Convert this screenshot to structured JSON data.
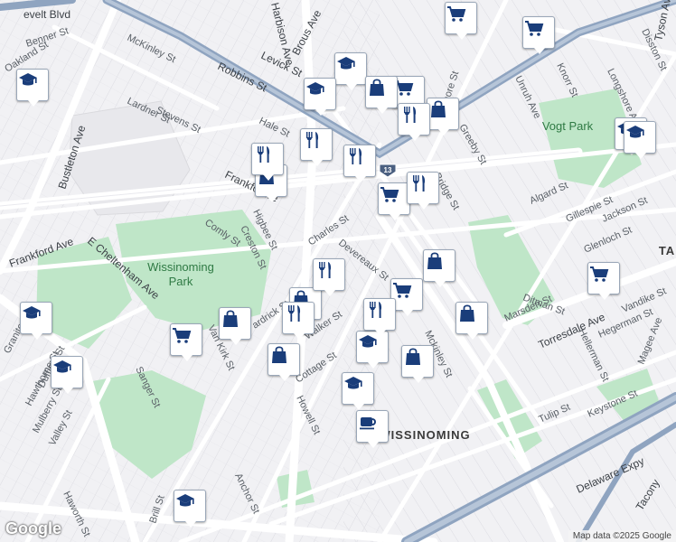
{
  "map": {
    "attribution": "Map data ©2025 Google",
    "logo": "Google",
    "neighborhood": "WISSINOMING",
    "parks": [
      {
        "name": "Wissinoming Park",
        "lines": [
          "Wissinoming",
          "Park"
        ]
      },
      {
        "name": "Vogt Park",
        "lines": [
          "Vogt Park"
        ]
      }
    ],
    "route_shield": "13",
    "corner_label": "TA",
    "streets": [
      {
        "name": "Roosevelt Blvd",
        "text": "evelt Blvd"
      },
      {
        "name": "Benner St",
        "text": "Benner St"
      },
      {
        "name": "Oakland St",
        "text": "Oakland St"
      },
      {
        "name": "McKinley St",
        "text": "McKinley St"
      },
      {
        "name": "Robbins St",
        "text": "Robbins St"
      },
      {
        "name": "Stevens St",
        "text": "Stevens St"
      },
      {
        "name": "Lardner St",
        "text": "Lardner St"
      },
      {
        "name": "Hale St",
        "text": "Hale St"
      },
      {
        "name": "Bustleton Ave",
        "text": "Bustleton Ave"
      },
      {
        "name": "Harbison Ave",
        "text": "Harbison Ave"
      },
      {
        "name": "Brous Ave",
        "text": "Brous Ave"
      },
      {
        "name": "Levick St",
        "text": "Levick St"
      },
      {
        "name": "Frankford Ave",
        "text": "Frankford Ave"
      },
      {
        "name": "Frankford Ave north",
        "text": "Frankfo Ave"
      },
      {
        "name": "Comly St",
        "text": "Comly St"
      },
      {
        "name": "Higbee St",
        "text": "Higbee St"
      },
      {
        "name": "Creston St",
        "text": "Creston St"
      },
      {
        "name": "Charles St",
        "text": "Charles St"
      },
      {
        "name": "Devereaux St",
        "text": "Devereaux St"
      },
      {
        "name": "Cottage St",
        "text": "Cottage St"
      },
      {
        "name": "Walker St",
        "text": "Walker St"
      },
      {
        "name": "E Cheltenham Ave",
        "text": "E Cheltenham Ave"
      },
      {
        "name": "Van Kirk St",
        "text": "Van Kirk St"
      },
      {
        "name": "Hardrick St",
        "text": "ardrick St"
      },
      {
        "name": "Sanger St",
        "text": "Sanger St"
      },
      {
        "name": "Bridge St",
        "text": "Bridge St"
      },
      {
        "name": "Passmore St",
        "text": "Passmore St"
      },
      {
        "name": "Greeby St",
        "text": "Greeby St"
      },
      {
        "name": "Unruh Ave",
        "text": "Unruh Ave"
      },
      {
        "name": "Knorr St",
        "text": "Knorr St"
      },
      {
        "name": "Longshore Ave",
        "text": "Longshore Ave"
      },
      {
        "name": "Disston St",
        "text": "Disston St"
      },
      {
        "name": "Tyson Ave",
        "text": "Tyson Ave"
      },
      {
        "name": "Algard St",
        "text": "Algard St"
      },
      {
        "name": "Gillespie St",
        "text": "Gillespie St"
      },
      {
        "name": "Jackson St",
        "text": "Jackson St"
      },
      {
        "name": "Glenloch St",
        "text": "Glenloch St"
      },
      {
        "name": "Ditman St",
        "text": "Ditman St"
      },
      {
        "name": "Marsden St",
        "text": "Marsden St"
      },
      {
        "name": "Torresdale Ave",
        "text": "Torresdale Ave"
      },
      {
        "name": "Vandike St",
        "text": "Vandike St"
      },
      {
        "name": "Hegerman St",
        "text": "Hegerman St"
      },
      {
        "name": "Keystone St",
        "text": "Keystone St"
      },
      {
        "name": "Tulip St",
        "text": "Tulip St"
      },
      {
        "name": "Delaware Expy",
        "text": "Delaware Expy"
      },
      {
        "name": "Tacony",
        "text": "Tacony"
      },
      {
        "name": "Magee Ave",
        "text": "Magee Ave"
      },
      {
        "name": "Anchor St",
        "text": "Anchor St"
      },
      {
        "name": "Haworth St",
        "text": "Haworth St"
      },
      {
        "name": "Mulberry St",
        "text": "Mulberry St"
      },
      {
        "name": "Duffield St",
        "text": "Duffield St"
      },
      {
        "name": "Granite St",
        "text": "Granite St"
      },
      {
        "name": "Howell St",
        "text": "Howell St"
      },
      {
        "name": "Hawthorne St",
        "text": "Hawthorne St"
      },
      {
        "name": "Valley St",
        "text": "Valley St"
      },
      {
        "name": "Brill St",
        "text": "Brill St"
      },
      {
        "name": "Mckinley St",
        "text": "Mckinley St"
      },
      {
        "name": "Hellerman St",
        "text": "Hellerman St"
      }
    ],
    "pois": [
      {
        "type": "school",
        "icon": "graduation-cap-icon"
      },
      {
        "type": "grocery",
        "icon": "shopping-cart-icon"
      },
      {
        "type": "shopping",
        "icon": "shopping-bag-icon"
      },
      {
        "type": "restaurant",
        "icon": "fork-knife-icon"
      },
      {
        "type": "cafe",
        "icon": "coffee-cup-icon"
      }
    ],
    "colors": {
      "background": "#f1f1f4",
      "park": "#bfe6c8",
      "highway": "#8fa4c0",
      "poi_icon": "#1a3d7a"
    }
  }
}
